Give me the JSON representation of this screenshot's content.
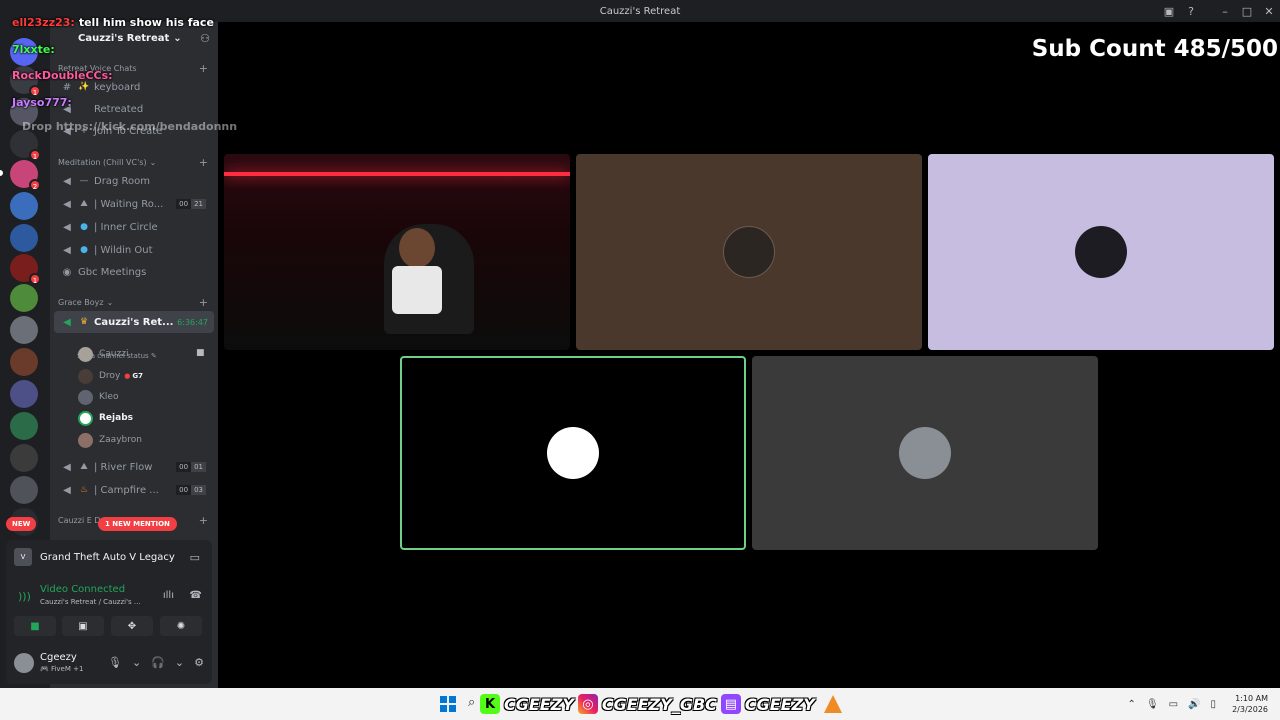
{
  "window": {
    "title": "Cauzzi's Retreat"
  },
  "server": {
    "name": "Cauzzi's Retreat"
  },
  "categories": {
    "retreat_voice": "Retreat Voice Chats",
    "meditation": "Meditation (Chill VC's)",
    "grace_boyz": "Grace Boyz",
    "cauzzi_e": "Cauzzi E D"
  },
  "channels": {
    "keyboard": "keyboard",
    "retreated": "Retreated",
    "join_to_create": "Join To Create",
    "drag_room": "Drag Room",
    "waiting_room": "| Waiting Ro...",
    "waiting_room_counts": [
      "00",
      "21"
    ],
    "inner_circle": "| Inner Circle",
    "wildin_out": "| Wildin Out",
    "gbc_meetings": "Gbc Meetings",
    "cauzzi_retreat": "Cauzzi's Ret...",
    "cauzzi_retreat_timer": "6:36:47",
    "channel_status": "Set a channel status",
    "river_flow": "| River Flow",
    "river_flow_counts": [
      "00",
      "01"
    ],
    "campfire": "| Campfire ...",
    "campfire_counts": [
      "00",
      "03"
    ]
  },
  "members": [
    {
      "name": "Cauzzi",
      "tag": ""
    },
    {
      "name": "Droy",
      "tag": "G7"
    },
    {
      "name": "Kleo",
      "tag": ""
    },
    {
      "name": "Rejabs",
      "tag": ""
    },
    {
      "name": "Zaaybron",
      "tag": ""
    }
  ],
  "pills": {
    "new": "NEW",
    "mention": "1 NEW MENTION"
  },
  "activity": {
    "game": "Grand Theft Auto V Legacy"
  },
  "voice": {
    "status": "Video Connected",
    "location": "Cauzzi's Retreat / Cauzzi's ..."
  },
  "user": {
    "name": "Cgeezy",
    "status": "FiveM +1"
  },
  "chat": [
    {
      "user": "ell23zz23:",
      "text": "tell him show his face",
      "color": "#ff3b3b"
    },
    {
      "user": "7lxxte:",
      "text": "",
      "color": "#3dff4a"
    },
    {
      "user": "RockDoubleCCs:",
      "text": "",
      "color": "#ff5a9e"
    },
    {
      "user": "Jayso777:",
      "text": "",
      "color": "#c87bff"
    }
  ],
  "chat_faded": "Drop https://kick.com/bendadonnn",
  "sub_count": "Sub Count 485/500",
  "brandbar": {
    "kick": "CGEEZY",
    "instagram": "CGEEZY_GBC",
    "twitch": "CGEEZY"
  },
  "clock": {
    "time": "1:10 AM",
    "date": "2/3/2026"
  },
  "colors": {
    "accent_green": "#23a55a",
    "danger": "#f23f43"
  }
}
